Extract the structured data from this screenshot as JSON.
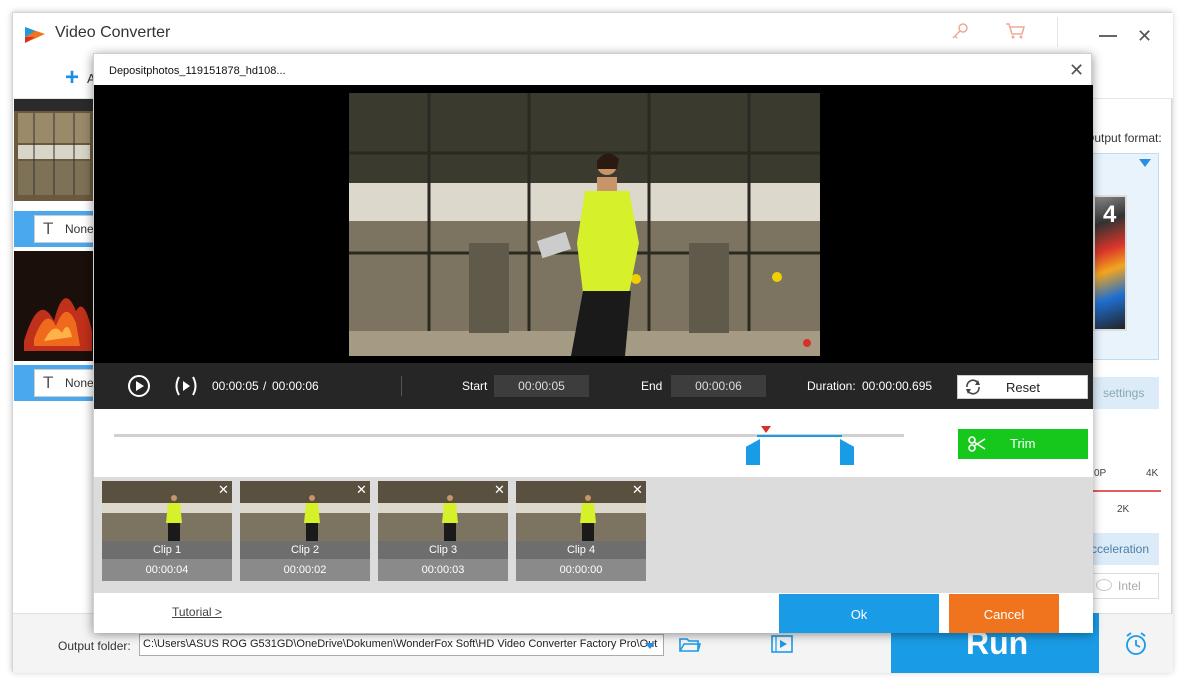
{
  "app": {
    "title": "Video Converter",
    "toolbar": {
      "add_label": "A"
    },
    "file_list": [
      {
        "subtitle_value": "None"
      },
      {
        "subtitle_value": "None"
      }
    ],
    "right_panel": {
      "output_format_label": "Output format:",
      "format_tile_text": "4",
      "settings_label": "settings",
      "quality_labels": [
        "0P",
        "4K",
        "2K"
      ],
      "acceleration_label": "cceleration",
      "intel_label": "Intel"
    },
    "bottom": {
      "output_folder_label": "Output folder:",
      "output_path": "C:\\Users\\ASUS ROG G531GD\\OneDrive\\Dokumen\\WonderFox Soft\\HD Video Converter Factory Pro\\Out",
      "run_label": "Run"
    }
  },
  "dialog": {
    "title": "Depositphotos_119151878_hd108...",
    "player": {
      "current_time": "00:00:05",
      "separator": "/",
      "total_time": "00:00:06",
      "start_label": "Start",
      "start_value": "00:00:05",
      "end_label": "End",
      "end_value": "00:00:06",
      "duration_label": "Duration:",
      "duration_value": "00:00:00.695",
      "reset_label": "Reset"
    },
    "trim_label": "Trim",
    "clips": [
      {
        "name": "Clip 1",
        "duration": "00:00:04"
      },
      {
        "name": "Clip 2",
        "duration": "00:00:02"
      },
      {
        "name": "Clip 3",
        "duration": "00:00:03"
      },
      {
        "name": "Clip 4",
        "duration": "00:00:00"
      }
    ],
    "tutorial_label": "Tutorial >",
    "ok_label": "Ok",
    "cancel_label": "Cancel"
  },
  "colors": {
    "accent_blue": "#1a9be6",
    "trim_green": "#17c81c",
    "cancel_orange": "#f0741e",
    "playhead_red": "#d9302a"
  }
}
